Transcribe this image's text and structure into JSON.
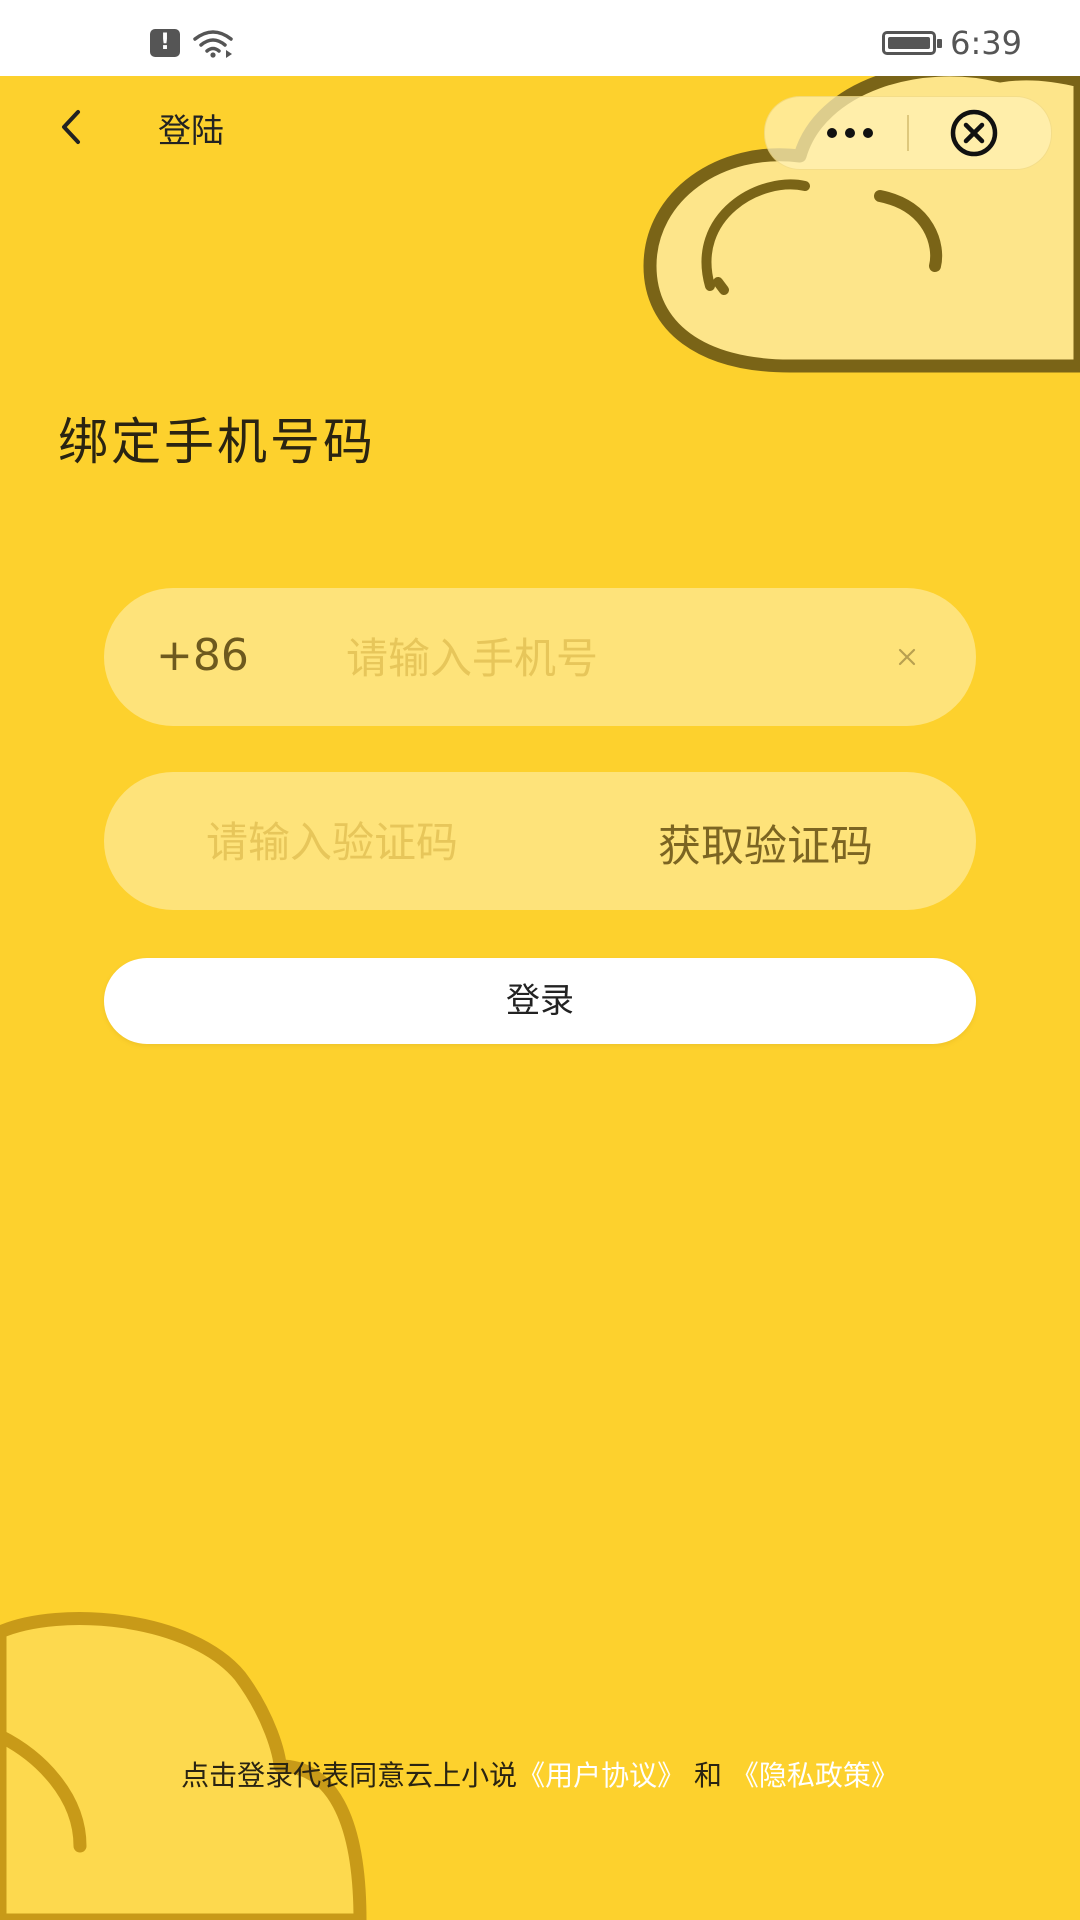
{
  "status_bar": {
    "alert_icon_text": "!",
    "time": "6:39"
  },
  "nav": {
    "title": "登陆"
  },
  "page_title": "绑定手机号码",
  "phone_field": {
    "country_code": "+86",
    "placeholder": "请输入手机号",
    "value": ""
  },
  "code_field": {
    "placeholder": "请输入验证码",
    "value": "",
    "get_code_label": "获取验证码"
  },
  "login_button": "登录",
  "agreement": {
    "prefix": "点击登录代表同意云上小说",
    "user_agreement": "《用户协议》",
    "conjunction": " 和 ",
    "privacy_policy": "《隐私政策》"
  },
  "colors": {
    "background": "#fdd12d",
    "link": "#ffffff",
    "cloud_outline": "#7a6417"
  },
  "icons": [
    "wifi-icon",
    "battery-icon",
    "back-icon",
    "more-icon",
    "close-circle-icon",
    "clear-icon"
  ]
}
